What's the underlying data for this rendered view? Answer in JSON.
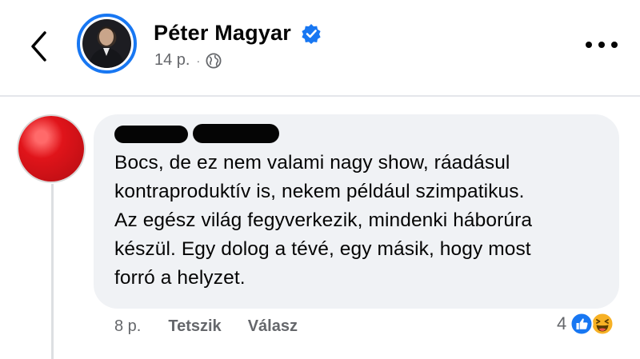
{
  "header": {
    "back_icon": "chevron-left-icon",
    "author_name": "Péter Magyar",
    "verified_color": "#1877f2",
    "post_time": "14 p.",
    "separator": "·",
    "audience_icon": "globe-icon",
    "more_icon": "more-dots-icon"
  },
  "comment": {
    "text_lines": [
      "Bocs, de ez nem valami nagy show, ráadásul",
      "kontraproduktív is, nekem például szimpatikus.",
      "Az egész világ fegyverkezik, mindenki háborúra",
      "készül. Egy dolog a tévé, egy másik, hogy most",
      "forró a helyzet."
    ],
    "time": "8 p.",
    "like_label": "Tetszik",
    "reply_label": "Válasz",
    "reaction_count": "4",
    "reactions": [
      "like-icon",
      "haha-icon"
    ]
  },
  "colors": {
    "accent": "#1877f2",
    "bubble": "#f0f2f5",
    "secondary_text": "#65676b"
  }
}
